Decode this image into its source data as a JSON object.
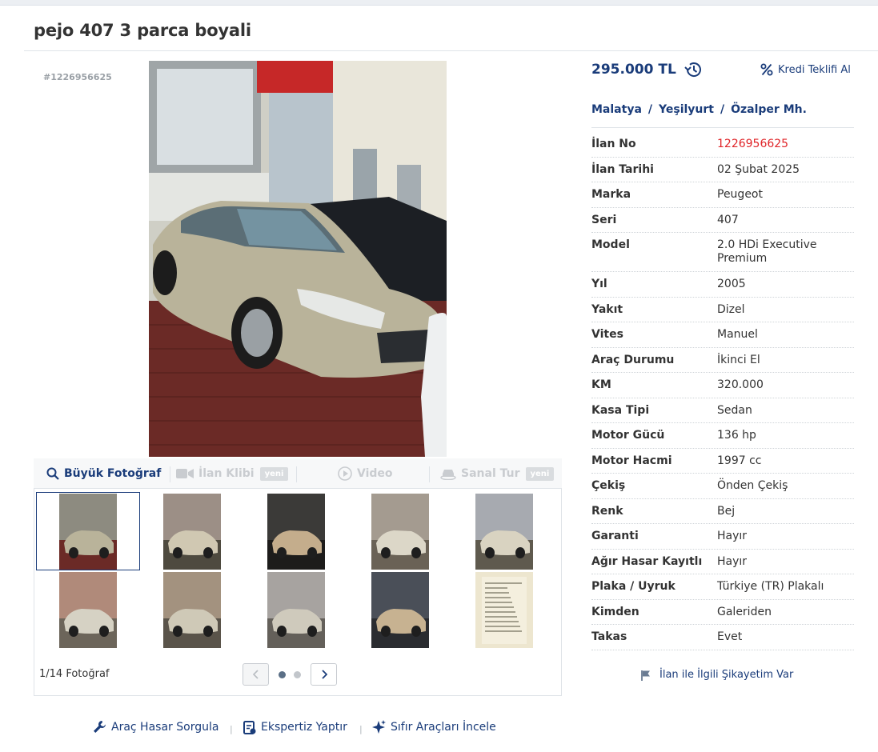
{
  "title": "pejo 407 3 parca boyali",
  "listing_id_tag": "#1226956625",
  "media": {
    "tabs": [
      {
        "label": "Büyük Fotoğraf",
        "badge": ""
      },
      {
        "label": "İlan Klibi",
        "badge": "yeni"
      },
      {
        "label": "Video",
        "badge": ""
      },
      {
        "label": "Sanal Tur",
        "badge": "yeni"
      }
    ],
    "photo_count": "1/14 Fotoğraf",
    "thumbnails": [
      "photo-1",
      "photo-2",
      "photo-3",
      "photo-4",
      "photo-5",
      "photo-6",
      "photo-7",
      "photo-8",
      "photo-9",
      "photo-10"
    ]
  },
  "price": "295.000 TL",
  "credit_label": "Kredi Teklifi Al",
  "location": {
    "city": "Malatya",
    "district": "Yeşilyurt",
    "neighborhood": "Özalper Mh."
  },
  "specs": [
    {
      "key": "İlan No",
      "value": "1226956625"
    },
    {
      "key": "İlan Tarihi",
      "value": "02 Şubat 2025"
    },
    {
      "key": "Marka",
      "value": "Peugeot"
    },
    {
      "key": "Seri",
      "value": "407"
    },
    {
      "key": "Model",
      "value": "2.0 HDi Executive Premium"
    },
    {
      "key": "Yıl",
      "value": "2005"
    },
    {
      "key": "Yakıt",
      "value": "Dizel"
    },
    {
      "key": "Vites",
      "value": "Manuel"
    },
    {
      "key": "Araç Durumu",
      "value": "İkinci El"
    },
    {
      "key": "KM",
      "value": "320.000"
    },
    {
      "key": "Kasa Tipi",
      "value": "Sedan"
    },
    {
      "key": "Motor Gücü",
      "value": "136 hp"
    },
    {
      "key": "Motor Hacmi",
      "value": "1997 cc"
    },
    {
      "key": "Çekiş",
      "value": "Önden Çekiş"
    },
    {
      "key": "Renk",
      "value": "Bej"
    },
    {
      "key": "Garanti",
      "value": "Hayır"
    },
    {
      "key": "Ağır Hasar Kayıtlı",
      "value": "Hayır"
    },
    {
      "key": "Plaka / Uyruk",
      "value": "Türkiye (TR) Plakalı"
    },
    {
      "key": "Kimden",
      "value": "Galeriden"
    },
    {
      "key": "Takas",
      "value": "Evet"
    }
  ],
  "complaint_label": "İlan ile İlgili Şikayetim Var",
  "bottom_links": [
    {
      "label": "Araç Hasar Sorgula"
    },
    {
      "label": "Ekspertiz Yaptır"
    },
    {
      "label": "Sıfır Araçları İncele"
    }
  ],
  "colors": {
    "brand_blue": "#1a3c7a",
    "highlight_red": "#e0262a",
    "disabled_gray": "#c9ccd0"
  }
}
